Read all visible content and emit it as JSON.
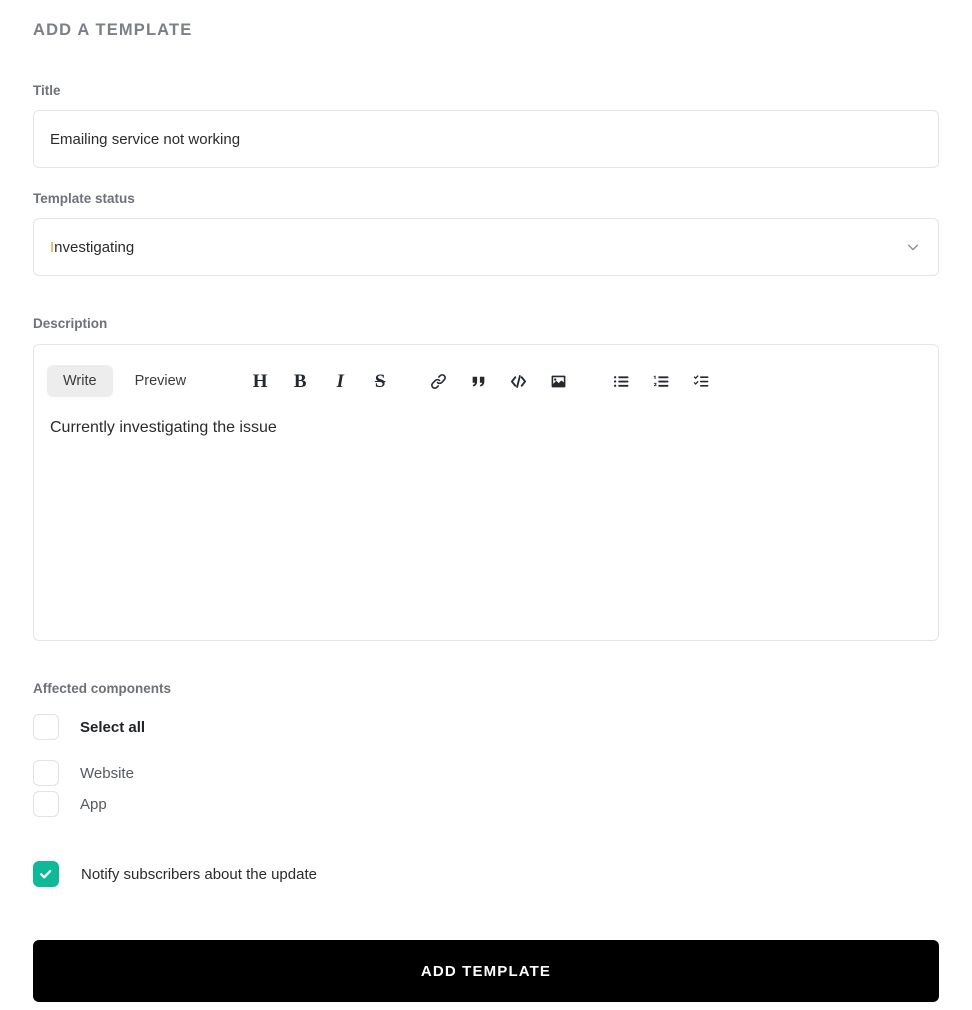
{
  "header": {
    "title": "ADD A TEMPLATE"
  },
  "form": {
    "title_field": {
      "label": "Title",
      "value": "Emailing service not working",
      "placeholder": "Title"
    },
    "status_field": {
      "label": "Template status",
      "value": "Investigating",
      "value_initial": "I",
      "value_rest": "nvestigating",
      "status_color": "#d9a63c",
      "chevron_icon": "chevron-down-icon"
    },
    "description_field": {
      "label": "Description",
      "tabs": [
        {
          "label": "Write",
          "active": true
        },
        {
          "label": "Preview",
          "active": false
        }
      ],
      "toolbar": [
        {
          "name": "heading-icon",
          "glyph": "H",
          "style": "bold"
        },
        {
          "name": "bold-icon",
          "glyph": "B",
          "style": "bold"
        },
        {
          "name": "italic-icon",
          "glyph": "I",
          "style": "italic"
        },
        {
          "name": "strikethrough-icon",
          "glyph": "S",
          "style": "strike"
        },
        {
          "name": "link-icon",
          "glyph": "",
          "style": "svg"
        },
        {
          "name": "quote-icon",
          "glyph": "",
          "style": "svg"
        },
        {
          "name": "code-icon",
          "glyph": "",
          "style": "svg"
        },
        {
          "name": "image-icon",
          "glyph": "",
          "style": "svg"
        },
        {
          "name": "unordered-list-icon",
          "glyph": "",
          "style": "svg"
        },
        {
          "name": "ordered-list-icon",
          "glyph": "",
          "style": "svg"
        },
        {
          "name": "task-list-icon",
          "glyph": "",
          "style": "svg"
        }
      ],
      "value": "Currently investigating the issue",
      "placeholder": ""
    },
    "components_field": {
      "label": "Affected components",
      "select_all": {
        "label": "Select all",
        "checked": false
      },
      "items": [
        {
          "label": "Website",
          "checked": false
        },
        {
          "label": "App",
          "checked": false
        }
      ]
    },
    "notify_field": {
      "label": "Notify subscribers about the update",
      "checked": true,
      "accent_color": "#0fb998"
    },
    "submit": {
      "label": "ADD TEMPLATE",
      "background": "#000000"
    }
  }
}
